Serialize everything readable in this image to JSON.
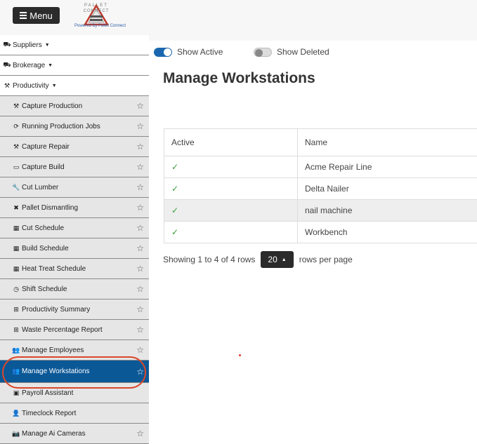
{
  "header": {
    "menu_label": "Menu",
    "logo_text_top": "PALLET",
    "logo_text_bottom": "CONNECT",
    "logo_caption": "Powered By Pallet Connect"
  },
  "sidebar": {
    "sections": [
      {
        "label": "Suppliers",
        "icon": "truck-icon"
      },
      {
        "label": "Brokerage",
        "icon": "truck-icon"
      },
      {
        "label": "Productivity",
        "icon": "hammer-icon"
      }
    ],
    "items": [
      {
        "label": "Capture Production",
        "icon": "hammer-icon"
      },
      {
        "label": "Running Production Jobs",
        "icon": "refresh-icon"
      },
      {
        "label": "Capture Repair",
        "icon": "hammer-icon"
      },
      {
        "label": "Capture Build",
        "icon": "ruler-icon"
      },
      {
        "label": "Cut Lumber",
        "icon": "wrench-icon"
      },
      {
        "label": "Pallet Dismantling",
        "icon": "tools-icon"
      },
      {
        "label": "Cut Schedule",
        "icon": "calendar-icon"
      },
      {
        "label": "Build Schedule",
        "icon": "calendar-icon"
      },
      {
        "label": "Heat Treat Schedule",
        "icon": "calendar-icon"
      },
      {
        "label": "Shift Schedule",
        "icon": "clock-icon"
      },
      {
        "label": "Productivity Summary",
        "icon": "table-icon"
      },
      {
        "label": "Waste Percentage Report",
        "icon": "table-icon"
      },
      {
        "label": "Manage Employees",
        "icon": "users-icon"
      },
      {
        "label": "Manage Workstations",
        "icon": "users-icon",
        "active": true
      },
      {
        "label": "Payroll Assistant",
        "icon": "calculator-icon"
      },
      {
        "label": "Timeclock Report",
        "icon": "user-clock-icon"
      },
      {
        "label": "Manage Ai Cameras",
        "icon": "camera-icon"
      }
    ]
  },
  "filters": {
    "show_active_label": "Show Active",
    "show_active_on": true,
    "show_deleted_label": "Show Deleted",
    "show_deleted_on": false
  },
  "page_title": "Manage Workstations",
  "table": {
    "columns": [
      "Active",
      "Name"
    ],
    "rows": [
      {
        "active": "✓",
        "name": "Acme Repair Line"
      },
      {
        "active": "✓",
        "name": "Delta Nailer"
      },
      {
        "active": "✓",
        "name": "nail machine"
      },
      {
        "active": "✓",
        "name": "Workbench"
      }
    ]
  },
  "pagination": {
    "showing_text": "Showing 1 to 4 of 4 rows",
    "page_size": "20",
    "suffix": "rows per page"
  },
  "colors": {
    "active_item_bg": "#0b5897",
    "check_color": "#3a9b3a",
    "toggle_on": "#1a67b0"
  }
}
